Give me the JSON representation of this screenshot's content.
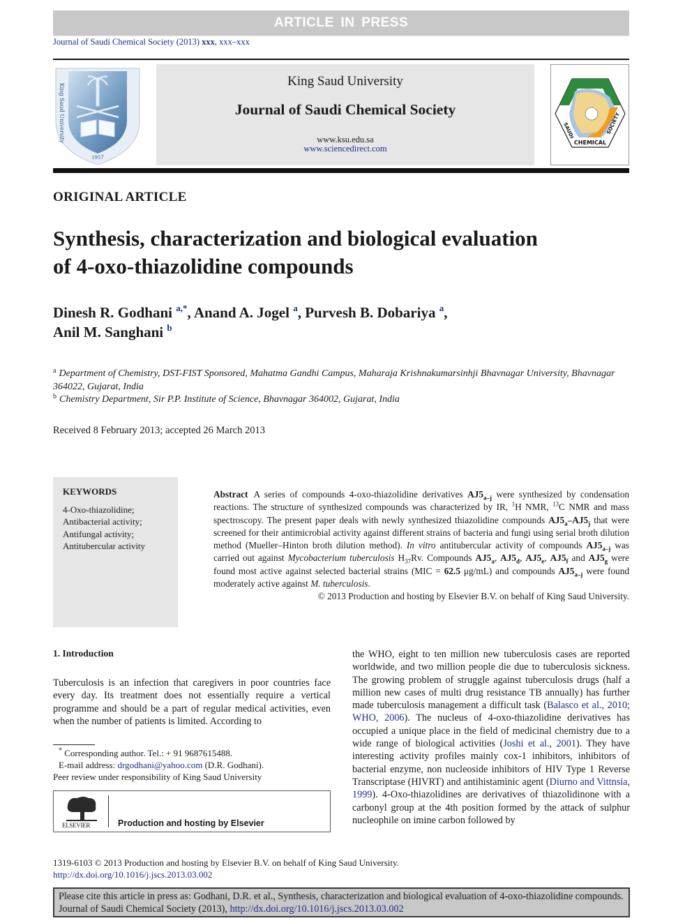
{
  "banner": {
    "text": "ARTICLE IN PRESS"
  },
  "running_head": {
    "journal": "Journal of Saudi Chemical Society (2013)",
    "volume": "xxx",
    "pages": ", xxx–xxx"
  },
  "masthead": {
    "university": "King Saud University",
    "journal": "Journal of Saudi Chemical Society",
    "url_1": "www.ksu.edu.sa",
    "url_2": "www.sciencedirect.com",
    "left_logo": "king-saud-university-crest",
    "left_logo_text": "King Saud University 1957",
    "right_logo": "saudi-chemical-society-logo",
    "right_logo_text": [
      "SAUDI",
      "CHEMICAL",
      "SOCIETY"
    ]
  },
  "article": {
    "type": "ORIGINAL ARTICLE",
    "title_line_1": "Synthesis, characterization and biological evaluation",
    "title_line_2": "of 4-oxo-thiazolidine compounds",
    "authors": [
      {
        "name": "Dinesh R. Godhani",
        "sup": "a,*",
        "sep": ", "
      },
      {
        "name": "Anand A. Jogel",
        "sup": "a",
        "sep": ", "
      },
      {
        "name": "Purvesh B. Dobariya",
        "sup": "a",
        "sep": ","
      },
      {
        "name": "Anil M. Sanghani",
        "sup": "b",
        "sep": ""
      }
    ],
    "affiliations": [
      {
        "mark": "a",
        "text": "Department of Chemistry, DST-FIST Sponsored, Mahatma Gandhi Campus, Maharaja Krishnakumarsinhji Bhavnagar University, Bhavnagar 364022, Gujarat, India"
      },
      {
        "mark": "b",
        "text": "Chemistry Department, Sir P.P. Institute of Science, Bhavnagar 364002, Gujarat, India"
      }
    ],
    "received": "Received 8 February 2013; accepted 26 March 2013"
  },
  "keywords": {
    "title": "KEYWORDS",
    "items": [
      "4-Oxo-thiazolidine;",
      "Antibacterial activity;",
      "Antifungal activity;",
      "Antitubercular activity"
    ]
  },
  "abstract": {
    "label": "Abstract",
    "p1": "A series of compounds 4-oxo-thiazolidine derivatives ",
    "c1": "AJ5",
    "c1sub": "a–j",
    "p2": " were synthesized by condensation reactions. The structure of synthesized compounds was characterized by IR, ",
    "h_sup": "1",
    "p3": "H NMR, ",
    "c_sup": "13",
    "p4": "C NMR and mass spectroscopy. The present paper deals with newly synthesized thiazolidine compounds ",
    "c2a": "AJ5",
    "c2asub": "a",
    "dash": "–",
    "c2b": "AJ5",
    "c2bsub": "j",
    "p5": " that were screened for their antimicrobial activity against different strains of bacteria and fungi using serial broth dilution method (Mueller–Hinton broth dilution method). ",
    "invitro": "In vitro",
    "p6": " antitubercular activity of compounds ",
    "c3": "AJ5",
    "c3sub": "a–j",
    "p7": " was carried out against ",
    "myco": "Mycobacterium tuberculosis",
    "p8a": " H",
    "h37": "37",
    "p8b": "Rv. Compounds ",
    "k1": "AJ5",
    "k1s": "a",
    "k2": "AJ5",
    "k2s": "d",
    "k3": "AJ5",
    "k3s": "e",
    "k4": "AJ5",
    "k4s": "f",
    "k5": "AJ5",
    "k5s": "g",
    "and": " and ",
    "p9": " were found most active against selected bacterial strains (MIC = ",
    "mic": "62.5",
    "p10": " μg/mL) and compounds ",
    "c4": "AJ5",
    "c4sub": "a–j",
    "p11": " were found moderately active against ",
    "mtb": "M. tuberculosis",
    "p12": ".",
    "copyright": "© 2013 Production and hosting by Elsevier B.V. on behalf of King Saud University."
  },
  "intro": {
    "heading": "1. Introduction",
    "col1": "Tuberculosis is an infection that caregivers in poor countries face every day. Its treatment does not essentially require a vertical programme and should be a part of regular medical activities, even when the number of patients is limited. According to",
    "col2_a": "the WHO, eight to ten million new tuberculosis cases are reported worldwide, and two million people die due to tuberculosis sickness. The growing problem of struggle against tuberculosis drugs (half a million new cases of multi drug resistance TB annually) has further made tuberculosis management a difficult task (",
    "ref1": "Balasco et al., 2010; WHO, 2006",
    "col2_b": "). The nucleus of 4-oxo-thiazolidine derivatives has occupied a unique place in the field of medicinal chemistry due to a wide range of biological activities (",
    "ref2": "Joshi et al., 2001",
    "col2_c": "). They have interesting activity profiles mainly cox-1 inhibitors, inhibitors of bacterial enzyme, non nucleoside inhibitors of HIV Type 1 Reverse Transcriptase (HIVRT) and antihistaminic agent (",
    "ref3": "Diurno and Vittnsia, 1999",
    "col2_d": "). 4-Oxo-thiazolidines are derivatives of thiazolidinone with a carbonyl group at the 4th position formed by the attack of sulphur nucleophile on imine carbon followed by"
  },
  "footnotes": {
    "mark": "*",
    "corresponding": " Corresponding author. Tel.: + 91 9687615488.",
    "email_label": "E-mail address: ",
    "email": "drgodhani@yahoo.com",
    "email_suffix": " (D.R. Godhani).",
    "peer_review": "Peer review under responsibility of King Saud University"
  },
  "elsevier": {
    "wordmark": "ELSEVIER",
    "text": "Production and hosting by Elsevier"
  },
  "footer": {
    "issn": "1319-6103 © 2013 Production and hosting by Elsevier B.V. on behalf of King Saud University.",
    "doi": "http://dx.doi.org/10.1016/j.jscs.2013.03.002"
  },
  "cite": {
    "text": "Please cite this article in press as: Godhani, D.R. et al., Synthesis, characterization and biological evaluation of 4-oxo-thiazolidine compounds. Journal of Saudi Chemical Society (2013), ",
    "doi": "http://dx.doi.org/10.1016/j.jscs.2013.03.002"
  },
  "colors": {
    "banner": "#c8c8c8",
    "masthead_bg": "#e6e6e6",
    "link": "#1c2e8c",
    "cite_bg": "#c8c8c8"
  }
}
